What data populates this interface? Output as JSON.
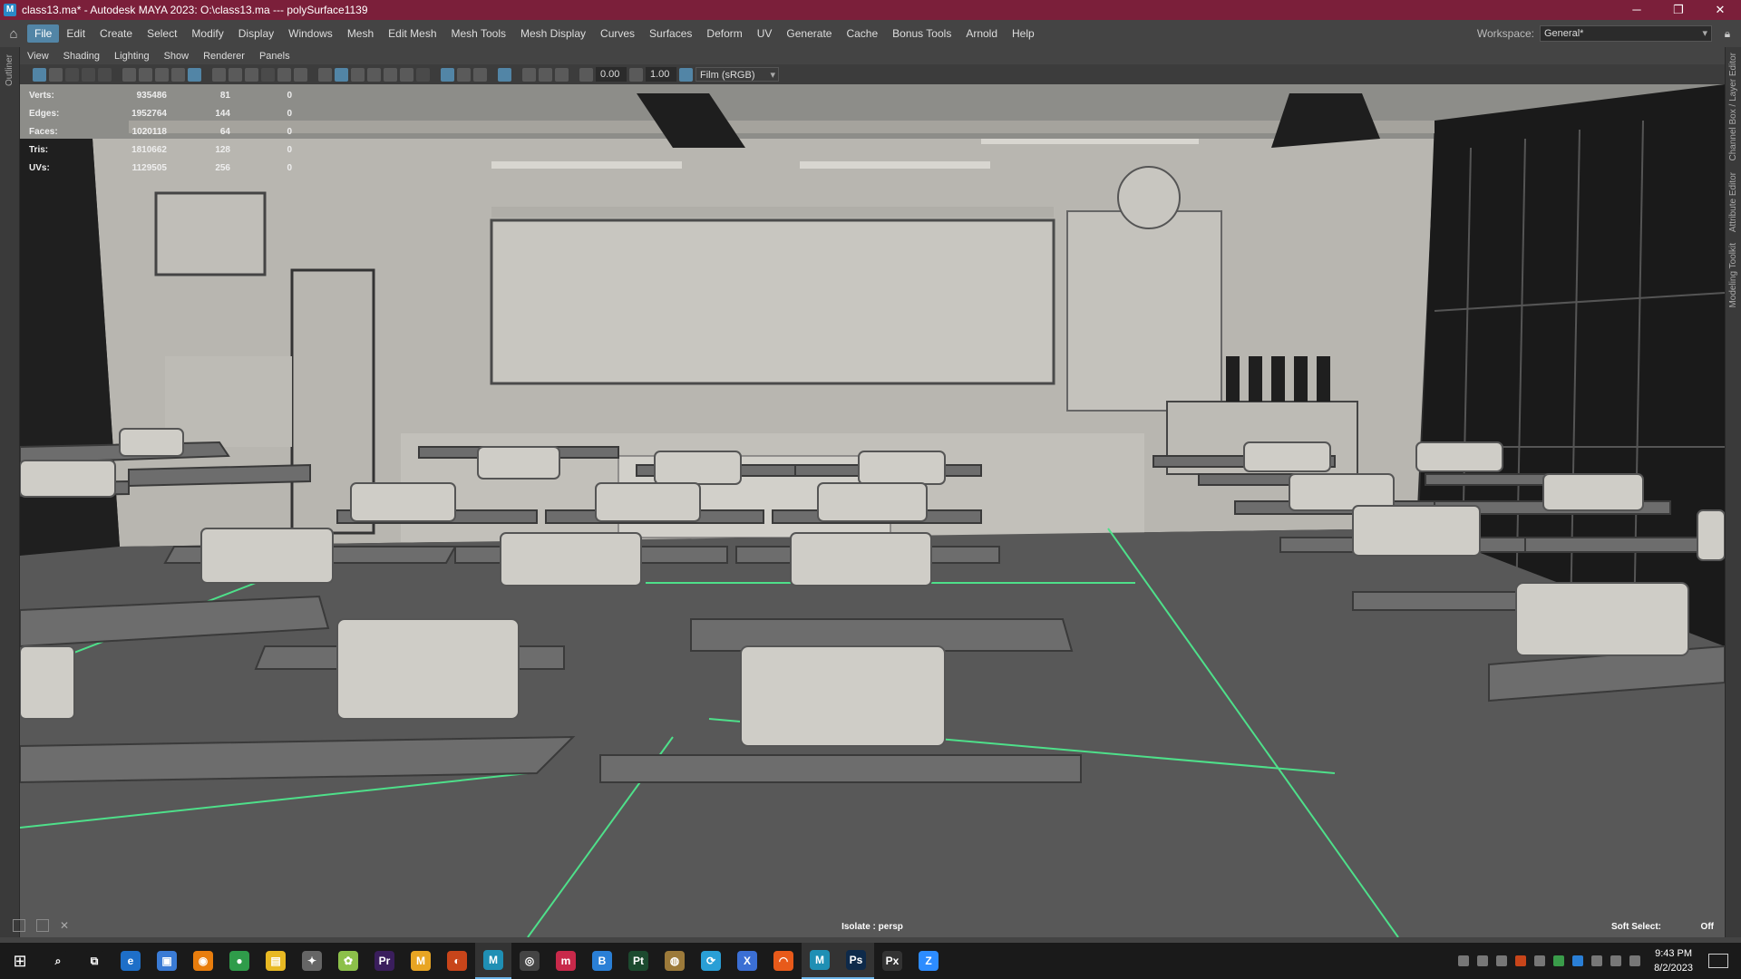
{
  "window": {
    "title": "class13.ma* - Autodesk MAYA 2023: O:\\class13.ma   ---   polySurface1139",
    "minimize": "─",
    "restore": "❐",
    "close": "✕"
  },
  "menu": {
    "items": [
      "File",
      "Edit",
      "Create",
      "Select",
      "Modify",
      "Display",
      "Windows",
      "Mesh",
      "Edit Mesh",
      "Mesh Tools",
      "Mesh Display",
      "Curves",
      "Surfaces",
      "Deform",
      "UV",
      "Generate",
      "Cache",
      "Bonus Tools",
      "Arnold",
      "Help"
    ],
    "workspace_label": "Workspace:",
    "workspace_value": "General*"
  },
  "left_panel": {
    "label": "Outliner"
  },
  "right_panel": {
    "labels": [
      "Channel Box / Layer Editor",
      "Attribute Editor",
      "Modeling Toolkit"
    ]
  },
  "panel_menu": [
    "View",
    "Shading",
    "Lighting",
    "Show",
    "Renderer",
    "Panels"
  ],
  "view_toolbar": {
    "exposure": "0.00",
    "gamma": "1.00",
    "color_space": "Film (sRGB)"
  },
  "hud": {
    "rows": [
      {
        "label": "Verts:",
        "value": "935486",
        "selected": "81",
        "components": "0"
      },
      {
        "label": "Edges:",
        "value": "1952764",
        "selected": "144",
        "components": "0"
      },
      {
        "label": "Faces:",
        "value": "1020118",
        "selected": "64",
        "components": "0"
      },
      {
        "label": "Tris:",
        "value": "1810662",
        "selected": "128",
        "components": "0"
      },
      {
        "label": "UVs:",
        "value": "1129505",
        "selected": "256",
        "components": "0"
      }
    ]
  },
  "viewport": {
    "camera_label": "Isolate : persp",
    "soft_select_label": "Soft Select:",
    "soft_select_value": "Off"
  },
  "taskbar": {
    "apps": [
      {
        "name": "search",
        "glyph": "⌕",
        "color": "#1a1a1a"
      },
      {
        "name": "task-view",
        "glyph": "⧉",
        "color": "#1a1a1a"
      },
      {
        "name": "edge",
        "glyph": "e",
        "color": "#1e6fc8"
      },
      {
        "name": "store",
        "glyph": "▣",
        "color": "#3a7bd5"
      },
      {
        "name": "blender",
        "glyph": "◉",
        "color": "#e87d0d"
      },
      {
        "name": "chrome",
        "glyph": "●",
        "color": "#2f9c4a"
      },
      {
        "name": "explorer",
        "glyph": "▤",
        "color": "#e8b923"
      },
      {
        "name": "app-grid",
        "glyph": "✦",
        "color": "#666666"
      },
      {
        "name": "app-leaf",
        "glyph": "✿",
        "color": "#8cc04a"
      },
      {
        "name": "premiere",
        "glyph": "Pr",
        "color": "#3a1e5c"
      },
      {
        "name": "marmoset",
        "glyph": "M",
        "color": "#e8a523"
      },
      {
        "name": "app-orange",
        "glyph": "◐",
        "color": "#c8451a"
      },
      {
        "name": "maya",
        "glyph": "M",
        "color": "#1f8fb4"
      },
      {
        "name": "app-ring",
        "glyph": "◎",
        "color": "#444444"
      },
      {
        "name": "mudbox",
        "glyph": "m",
        "color": "#c8294a"
      },
      {
        "name": "app-b",
        "glyph": "B",
        "color": "#2a7fd6"
      },
      {
        "name": "painter",
        "glyph": "Pt",
        "color": "#1c4a2f"
      },
      {
        "name": "app-globe",
        "glyph": "◍",
        "color": "#9c7a3a"
      },
      {
        "name": "app-cycle",
        "glyph": "⟳",
        "color": "#2a9fd6"
      },
      {
        "name": "app-x",
        "glyph": "X",
        "color": "#3b6fd4"
      },
      {
        "name": "houdini",
        "glyph": "◠",
        "color": "#e85a1a"
      },
      {
        "name": "maya-2",
        "glyph": "M",
        "color": "#1f8fb4"
      },
      {
        "name": "photoshop",
        "glyph": "Ps",
        "color": "#0e2a4a"
      },
      {
        "name": "pixologic",
        "glyph": "Px",
        "color": "#333333"
      },
      {
        "name": "zoom",
        "glyph": "Z",
        "color": "#2d8cff"
      }
    ],
    "time": "9:43 PM",
    "date": "8/2/2023"
  },
  "colors": {
    "title_bar": "#7b1f3a",
    "accent": "#5285a6",
    "grid": "#4ee08a"
  }
}
